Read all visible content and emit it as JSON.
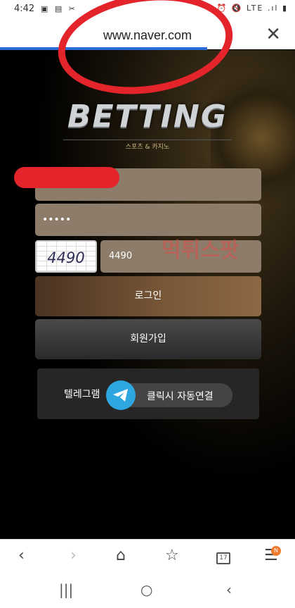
{
  "status_bar": {
    "time": "4:42",
    "left_icons": "▣ ▤ ✂",
    "right_icons": "⏰ 🔇 LTE .ıl ▮"
  },
  "browser": {
    "url": "www.naver.com",
    "close_symbol": "✕"
  },
  "logo": {
    "title": "BETTING",
    "subtitle": "스포츠 & 카지노"
  },
  "login_form": {
    "username_value": "",
    "password_value": "•••••",
    "captcha_image_text": "4490",
    "captcha_input_value": "4490",
    "login_label": "로그인",
    "signup_label": "회원가입"
  },
  "watermark": "먹튀스팟",
  "telegram": {
    "label": "텔레그램",
    "button_label": "클릭시 자동연결"
  },
  "browser_nav": {
    "back": "‹",
    "forward": "›",
    "home": "⌂",
    "bookmark": "☆",
    "tabs_count": "17",
    "menu": "☰",
    "badge": "N"
  },
  "system_nav": {
    "recents": "|||",
    "home": "○",
    "back": "‹"
  },
  "colors": {
    "accent_red": "#e3242b",
    "field": "#8c7c69",
    "telegram": "#2ea6e0"
  }
}
